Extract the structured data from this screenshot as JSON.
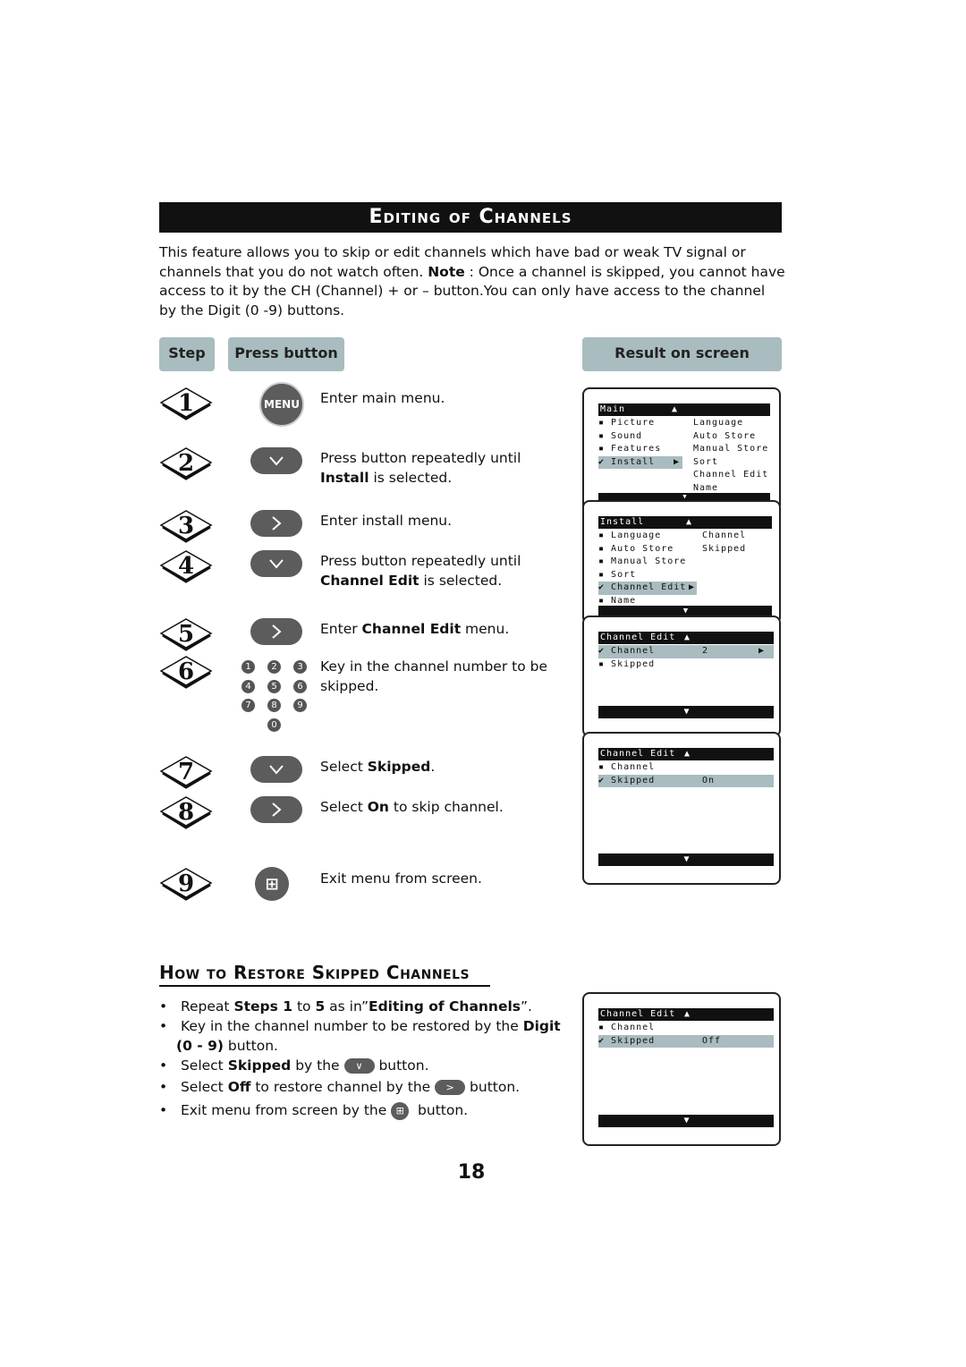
{
  "title": "Editing of Channels",
  "intro": {
    "p1": "This feature allows you to skip or edit channels which have bad or weak TV signal or channels that you do not watch often. ",
    "note_label": "Note",
    "p2": " : Once a channel is skipped, you cannot have access to it by the CH (Channel) + or – button.You can only have access to the channel by the Digit (0 -9) buttons."
  },
  "headers": {
    "step": "Step",
    "press": "Press button",
    "result": "Result on screen"
  },
  "steps": [
    {
      "num": "1",
      "button": "MENU",
      "text": "Enter main menu."
    },
    {
      "num": "2",
      "button": "down",
      "pre": "Press button repeatedly until ",
      "bold": "Install",
      "post": " is selected."
    },
    {
      "num": "3",
      "button": "right",
      "text": "Enter install menu."
    },
    {
      "num": "4",
      "button": "down",
      "pre": "Press button repeatedly until ",
      "bold": "Channel Edit",
      "post": " is selected."
    },
    {
      "num": "5",
      "button": "right",
      "pre": "Enter ",
      "bold": "Channel Edit",
      "post": " menu."
    },
    {
      "num": "6",
      "button": "digits",
      "text": "Key in the channel number to be skipped."
    },
    {
      "num": "7",
      "button": "down",
      "pre": "Select ",
      "bold": "Skipped",
      "post": "."
    },
    {
      "num": "8",
      "button": "right",
      "pre": "Select ",
      "bold": "On",
      "post": " to skip channel."
    },
    {
      "num": "9",
      "button": "exit",
      "text": "Exit menu from screen."
    }
  ],
  "digits": [
    "1",
    "2",
    "3",
    "4",
    "5",
    "6",
    "7",
    "8",
    "9",
    "0"
  ],
  "screens": {
    "main": {
      "title": "Main",
      "left": [
        "Picture",
        "Sound",
        "Features",
        "Install"
      ],
      "right": [
        "Language",
        "Auto Store",
        "Manual Store",
        "Sort",
        "Channel Edit",
        "Name"
      ]
    },
    "install": {
      "title": "Install",
      "left": [
        "Language",
        "Auto Store",
        "Manual Store",
        "Sort",
        "Channel Edit",
        "Name"
      ],
      "right": [
        "Channel",
        "Skipped"
      ]
    },
    "edit1": {
      "title": "Channel Edit",
      "rows": [
        "Channel",
        "Skipped"
      ],
      "value": "2"
    },
    "edit2": {
      "title": "Channel Edit",
      "rows": [
        "Channel",
        "Skipped"
      ],
      "value": "On"
    },
    "edit3": {
      "title": "Channel Edit",
      "rows": [
        "Channel",
        "Skipped"
      ],
      "value": "Off"
    }
  },
  "restore": {
    "title": "How to Restore Skipped Channels",
    "b1": {
      "a": "Repeat ",
      "b": "Steps 1",
      "c": " to ",
      "d": "5",
      "e": " as in”",
      "f": "Editing of Channels",
      "g": "”."
    },
    "b2": {
      "a": "Key in the channel number to be restored by the ",
      "b": "Digit (0 - 9)",
      "c": " button."
    },
    "b3": {
      "a": "Select ",
      "b": "Skipped",
      "c": " by the ",
      "d": " button."
    },
    "b4": {
      "a": "Select ",
      "b": "Off",
      "c": " to restore channel by the ",
      "d": " button."
    },
    "b5": {
      "a": "Exit menu from screen by the ",
      "b": " button."
    }
  },
  "page_number": "18",
  "colors": {
    "header_bg": "#a9bcc0",
    "button": "#5c5c5c",
    "bar": "#111111"
  }
}
